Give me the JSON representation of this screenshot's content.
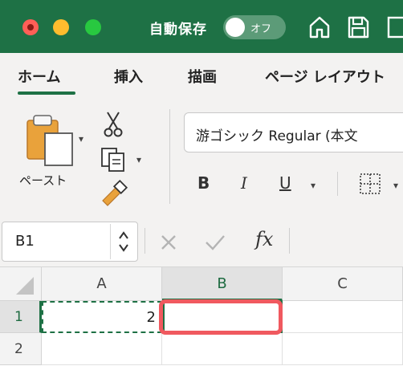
{
  "window": {
    "autosave_label": "自動保存",
    "autosave_toggle": "オフ",
    "icons": [
      "close-icon",
      "minimize-icon",
      "zoom-icon",
      "home-icon",
      "save-icon",
      "more-icon"
    ]
  },
  "ribbon": {
    "tabs": [
      "ホーム",
      "挿入",
      "描画",
      "ページ レイアウト"
    ],
    "active_tab": "ホーム",
    "clipboard": {
      "paste_label": "ペースト"
    },
    "font": {
      "name": "游ゴシック Regular (本文",
      "bold": "B",
      "italic": "I",
      "underline": "U"
    }
  },
  "formula_bar": {
    "name_box": "B1",
    "fx": "fx",
    "value": ""
  },
  "sheet": {
    "columns": [
      "A",
      "B",
      "C"
    ],
    "rows": [
      "1",
      "2"
    ],
    "selected_column": "B",
    "selected_row": "1",
    "cells": {
      "A1": "2",
      "B1": ""
    }
  },
  "colors": {
    "accent": "#1e7145",
    "highlight": "#f0595f"
  }
}
